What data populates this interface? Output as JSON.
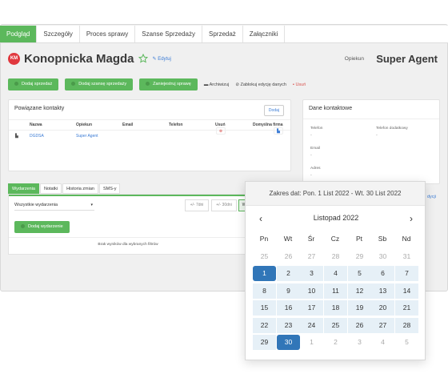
{
  "tabs": [
    "Podgląd",
    "Szczegóły",
    "Proces sprawy",
    "Szanse Sprzedaży",
    "Sprzedaż",
    "Załączniki"
  ],
  "header": {
    "initials": "KM",
    "name": "Konopnicka Magda",
    "edit_label": "Edytuj",
    "opiekun_label": "Opiekun",
    "opiekun_value": "Super Agent"
  },
  "actions": {
    "add_sale": "Dodaj sprzedaż",
    "add_opportunity": "Dodaj szansę sprzedaży",
    "schedule_case": "Zaniejestruj sprawę",
    "archive": "Archiwizuj",
    "lock_edit": "Zablokuj edycję danych",
    "delete": "Usuń"
  },
  "contacts": {
    "title": "Powiązane kontakty",
    "add_label": "Dodaj",
    "columns": [
      "Nazwa",
      "Opiekun",
      "Email",
      "Telefon",
      "Usuń",
      "Domyślna firma"
    ],
    "rows": [
      {
        "name": "DGDSA",
        "opiekun": "Super Agent",
        "email": "",
        "telefon": ""
      }
    ]
  },
  "contact_data": {
    "title": "Dane kontaktowe",
    "telefon_label": "Telefon",
    "telefon_value": "-",
    "telefon2_label": "Telefon dodatkowy",
    "telefon2_value": "-",
    "email_label": "Email",
    "email_value": "-",
    "adres_label": "Adres",
    "adres_value": "-",
    "edit_partial": "dycji"
  },
  "subtabs": [
    "Wydarzenia",
    "Notatki",
    "Historia zmian",
    "SMS-y"
  ],
  "events": {
    "filter_value": "Wszystkie wydarzenia",
    "range_7": "+/- 7dni",
    "range_30": "+/- 30dni",
    "range_partial": "W",
    "add_event": "Dodaj wydarzenie",
    "empty": "Brak wyników dla wybranych filtrów"
  },
  "calendar": {
    "range_text": "Zakres dat: Pon. 1 List 2022 - Wt. 30 List 2022",
    "month_label": "Listopad 2022",
    "weekdays": [
      "Pn",
      "Wt",
      "Śr",
      "Cz",
      "Pt",
      "Sb",
      "Nd"
    ],
    "weeks": [
      [
        "25",
        "26",
        "27",
        "28",
        "29",
        "30",
        "31"
      ],
      [
        "1",
        "2",
        "3",
        "4",
        "5",
        "6",
        "7"
      ],
      [
        "8",
        "9",
        "10",
        "11",
        "12",
        "13",
        "14"
      ],
      [
        "15",
        "16",
        "17",
        "18",
        "19",
        "20",
        "21"
      ],
      [
        "22",
        "23",
        "24",
        "25",
        "26",
        "27",
        "28"
      ],
      [
        "29",
        "30",
        "1",
        "2",
        "3",
        "4",
        "5"
      ]
    ],
    "range_start": "1",
    "range_end": "30"
  },
  "colors": {
    "accent_green": "#5cb85c",
    "selected_blue": "#3176b8",
    "range_bg": "#e6f0f7",
    "avatar_red": "#e0383e"
  }
}
